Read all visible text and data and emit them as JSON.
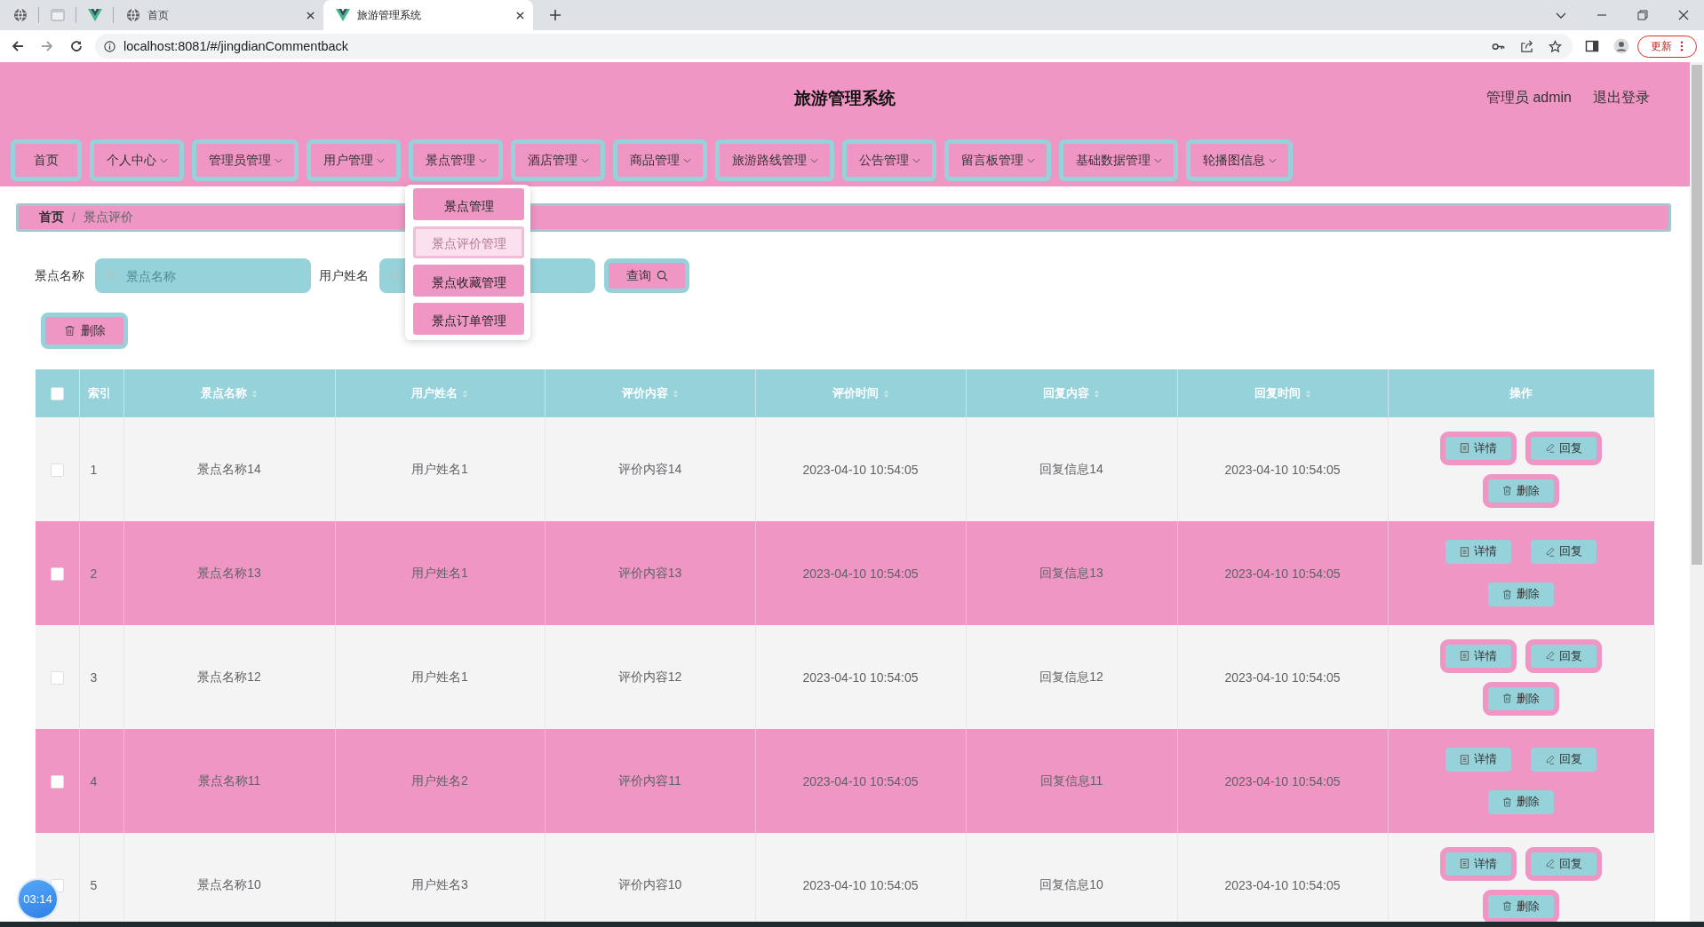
{
  "browser": {
    "tabs": [
      {
        "kind": "pinned",
        "selected": false
      },
      {
        "kind": "pinned",
        "selected": false
      },
      {
        "kind": "pinned",
        "selected": false
      },
      {
        "kind": "page",
        "title": "首页",
        "selected": false
      },
      {
        "kind": "page",
        "title": "旅游管理系统",
        "selected": true
      }
    ],
    "url": "localhost:8081/#/jingdianCommentback",
    "update_button": "更新"
  },
  "header": {
    "title": "旅游管理系统",
    "user": "管理员 admin",
    "logout": "退出登录"
  },
  "nav": [
    {
      "label": "首页",
      "dropdown": false
    },
    {
      "label": "个人中心",
      "dropdown": true
    },
    {
      "label": "管理员管理",
      "dropdown": true
    },
    {
      "label": "用户管理",
      "dropdown": true
    },
    {
      "label": "景点管理",
      "dropdown": true,
      "menu": [
        {
          "label": "景点管理",
          "highlighted": false
        },
        {
          "label": "景点评价管理",
          "highlighted": true
        },
        {
          "label": "景点收藏管理",
          "highlighted": false
        },
        {
          "label": "景点订单管理",
          "highlighted": false
        }
      ]
    },
    {
      "label": "酒店管理",
      "dropdown": true
    },
    {
      "label": "商品管理",
      "dropdown": true
    },
    {
      "label": "旅游路线管理",
      "dropdown": true
    },
    {
      "label": "公告管理",
      "dropdown": true
    },
    {
      "label": "留言板管理",
      "dropdown": true
    },
    {
      "label": "基础数据管理",
      "dropdown": true
    },
    {
      "label": "轮播图信息",
      "dropdown": true
    }
  ],
  "breadcrumb": {
    "items": [
      "首页",
      "景点评价"
    ],
    "separator": "/"
  },
  "search": {
    "fields": [
      {
        "label": "景点名称",
        "placeholder": "景点名称"
      },
      {
        "label": "用户姓名"
      }
    ],
    "query_button": "查询"
  },
  "delete_button": "删除",
  "table": {
    "select_all": {
      "checked": false
    },
    "columns": [
      {
        "label": "索引",
        "sortable": false
      },
      {
        "label": "景点名称",
        "sortable": true
      },
      {
        "label": "用户姓名",
        "sortable": true
      },
      {
        "label": "评价内容",
        "sortable": true
      },
      {
        "label": "评价时间",
        "sortable": true
      },
      {
        "label": "回复内容",
        "sortable": true
      },
      {
        "label": "回复时间",
        "sortable": true
      },
      {
        "label": "操作",
        "sortable": false
      }
    ],
    "rows": [
      {
        "checked": false,
        "cells": [
          "1",
          "景点名称14",
          "用户姓名1",
          "评价内容14",
          "2023-04-10 10:54:05",
          "回复信息14",
          "2023-04-10 10:54:05"
        ],
        "actions": [
          {
            "kind": "detail",
            "label": "详情"
          },
          {
            "kind": "reply",
            "label": "回复"
          },
          {
            "kind": "delete",
            "label": "删除"
          }
        ]
      },
      {
        "checked": false,
        "cells": [
          "2",
          "景点名称13",
          "用户姓名1",
          "评价内容13",
          "2023-04-10 10:54:05",
          "回复信息13",
          "2023-04-10 10:54:05"
        ],
        "actions": [
          {
            "kind": "detail",
            "label": "详情"
          },
          {
            "kind": "reply",
            "label": "回复"
          },
          {
            "kind": "delete",
            "label": "删除"
          }
        ]
      },
      {
        "checked": false,
        "cells": [
          "3",
          "景点名称12",
          "用户姓名1",
          "评价内容12",
          "2023-04-10 10:54:05",
          "回复信息12",
          "2023-04-10 10:54:05"
        ],
        "actions": [
          {
            "kind": "detail",
            "label": "详情"
          },
          {
            "kind": "reply",
            "label": "回复"
          },
          {
            "kind": "delete",
            "label": "删除"
          }
        ]
      },
      {
        "checked": false,
        "cells": [
          "4",
          "景点名称11",
          "用户姓名2",
          "评价内容11",
          "2023-04-10 10:54:05",
          "回复信息11",
          "2023-04-10 10:54:05"
        ],
        "actions": [
          {
            "kind": "detail",
            "label": "详情"
          },
          {
            "kind": "reply",
            "label": "回复"
          },
          {
            "kind": "delete",
            "label": "删除"
          }
        ]
      },
      {
        "checked": false,
        "cells": [
          "5",
          "景点名称10",
          "用户姓名3",
          "评价内容10",
          "2023-04-10 10:54:05",
          "回复信息10",
          "2023-04-10 10:54:05"
        ],
        "actions": [
          {
            "kind": "detail",
            "label": "详情"
          },
          {
            "kind": "reply",
            "label": "回复"
          },
          {
            "kind": "delete",
            "label": "删除"
          }
        ]
      }
    ]
  },
  "timer": "03:14"
}
